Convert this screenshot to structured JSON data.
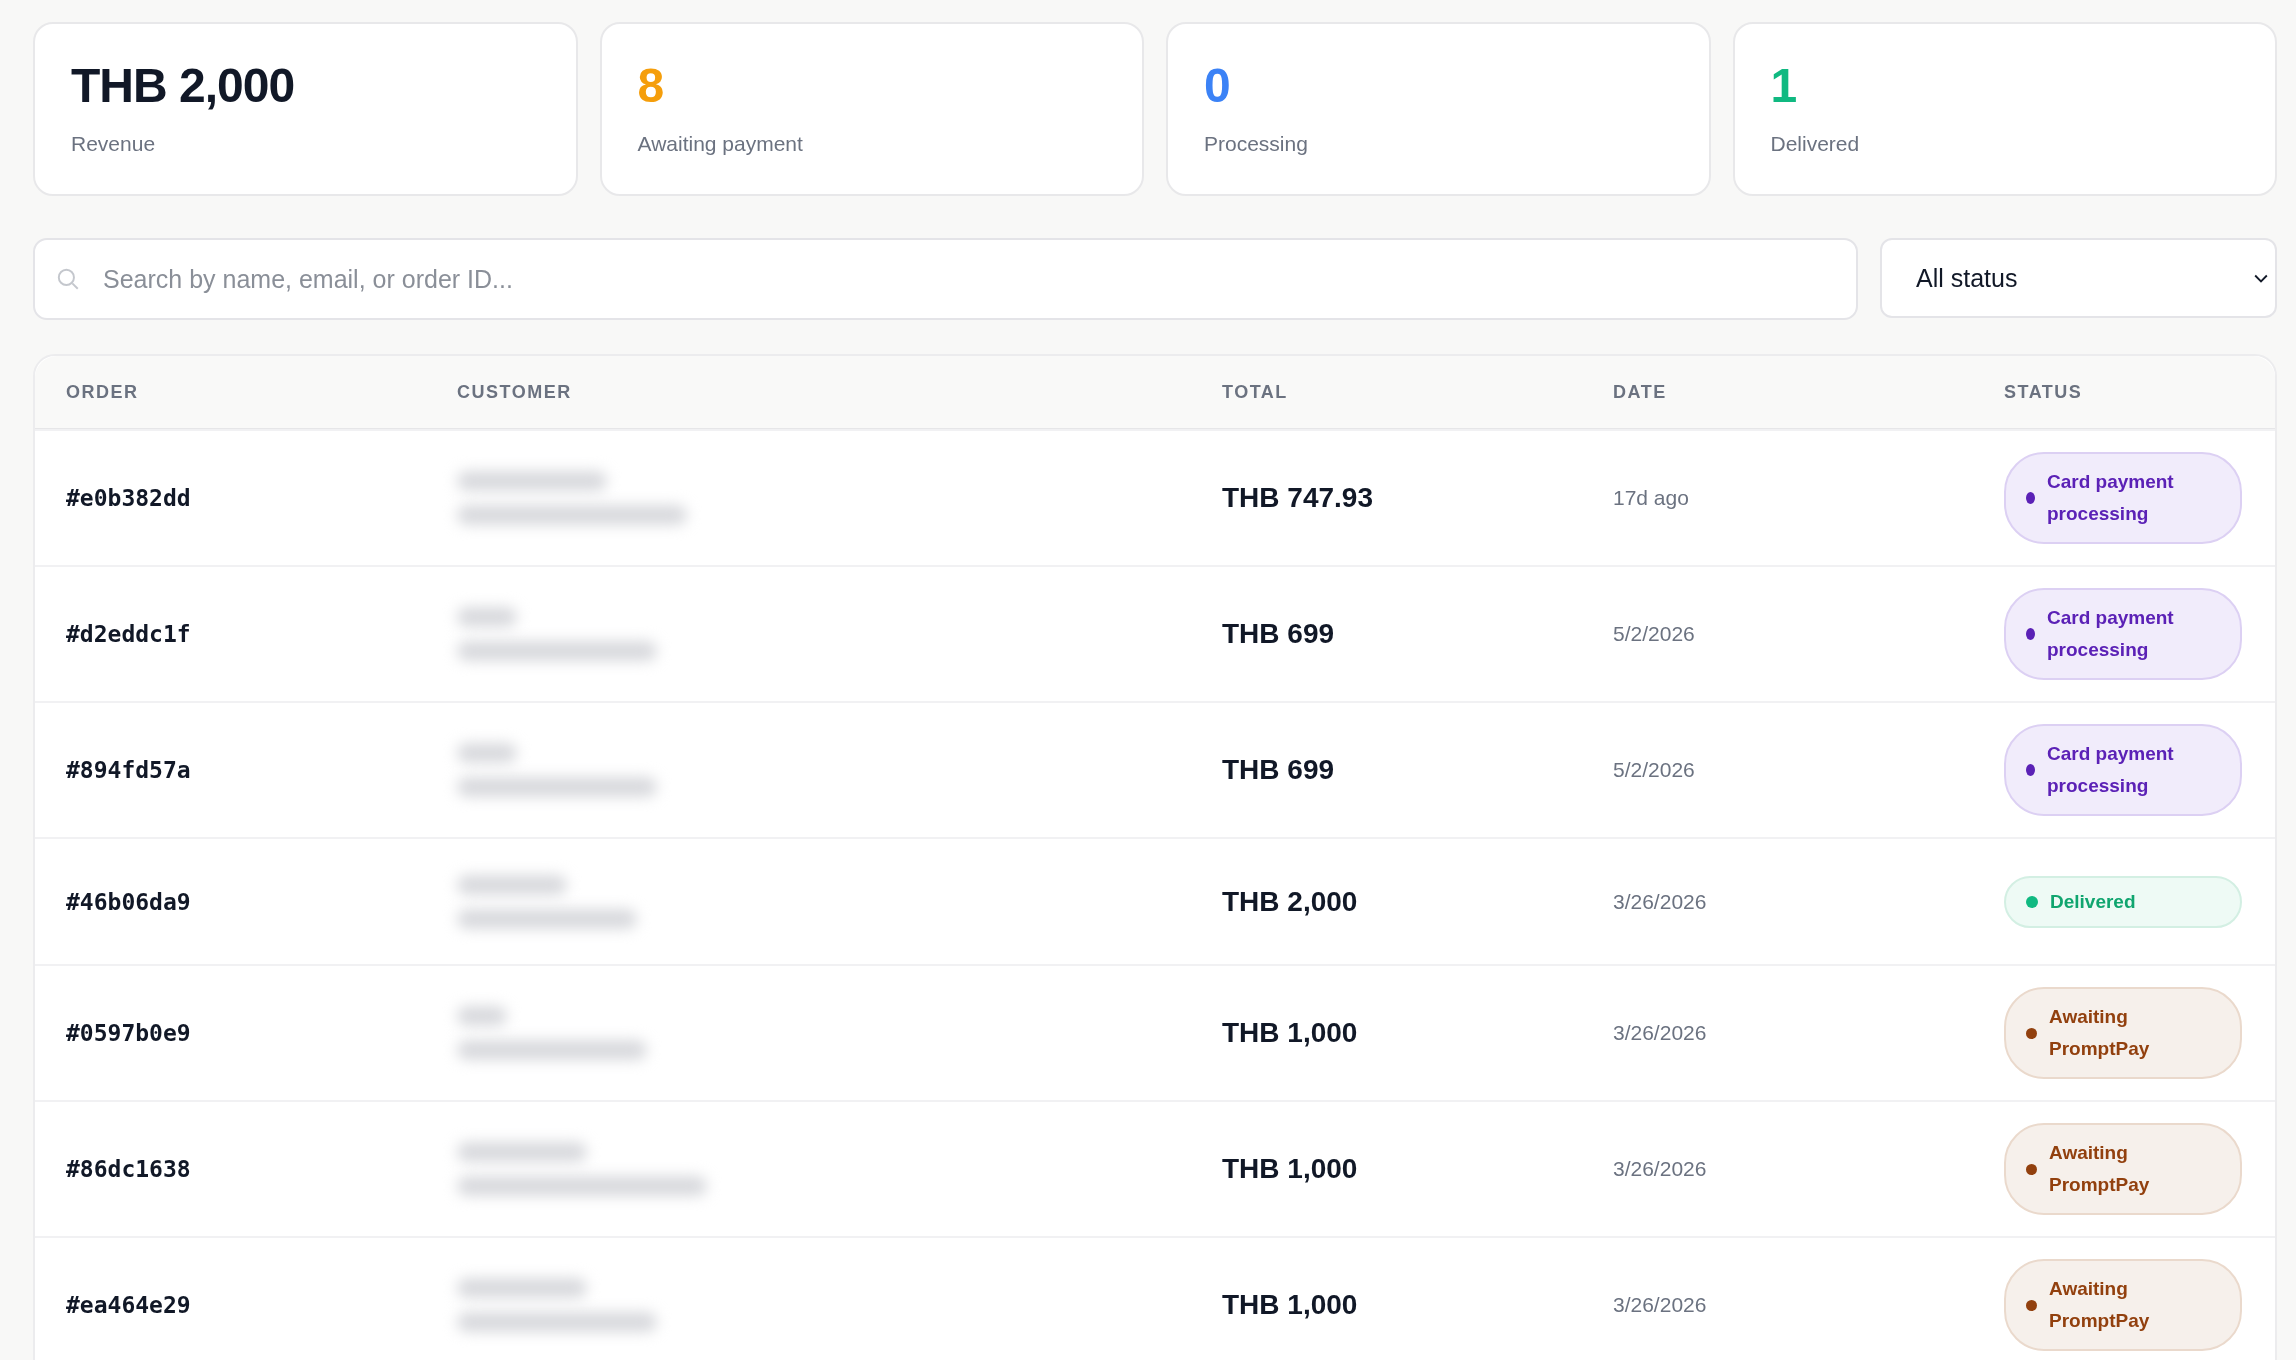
{
  "stats": [
    {
      "value": "THB 2,000",
      "label": "Revenue",
      "color": "#111827"
    },
    {
      "value": "8",
      "label": "Awaiting payment",
      "color": "#f59e0b"
    },
    {
      "value": "0",
      "label": "Processing",
      "color": "#3b82f6"
    },
    {
      "value": "1",
      "label": "Delivered",
      "color": "#10b981"
    }
  ],
  "search": {
    "placeholder": "Search by name, email, or order ID..."
  },
  "status_filter": {
    "value": "All status"
  },
  "table": {
    "columns": [
      "ORDER",
      "CUSTOMER",
      "TOTAL",
      "DATE",
      "STATUS"
    ],
    "rows": [
      {
        "order": "#e0b382dd",
        "total": "THB 747.93",
        "date": "17d ago",
        "status": {
          "kind": "processing",
          "label": "Card payment processing"
        }
      },
      {
        "order": "#d2eddc1f",
        "total": "THB 699",
        "date": "5/2/2026",
        "status": {
          "kind": "processing",
          "label": "Card payment processing"
        }
      },
      {
        "order": "#894fd57a",
        "total": "THB 699",
        "date": "5/2/2026",
        "status": {
          "kind": "processing",
          "label": "Card payment processing"
        }
      },
      {
        "order": "#46b06da9",
        "total": "THB 2,000",
        "date": "3/26/2026",
        "status": {
          "kind": "delivered",
          "label": "Delivered"
        }
      },
      {
        "order": "#0597b0e9",
        "total": "THB 1,000",
        "date": "3/26/2026",
        "status": {
          "kind": "awaiting",
          "label": "Awaiting PromptPay"
        }
      },
      {
        "order": "#86dc1638",
        "total": "THB 1,000",
        "date": "3/26/2026",
        "status": {
          "kind": "awaiting",
          "label": "Awaiting PromptPay"
        }
      },
      {
        "order": "#ea464e29",
        "total": "THB 1,000",
        "date": "3/26/2026",
        "status": {
          "kind": "awaiting",
          "label": "Awaiting PromptPay"
        }
      }
    ]
  }
}
